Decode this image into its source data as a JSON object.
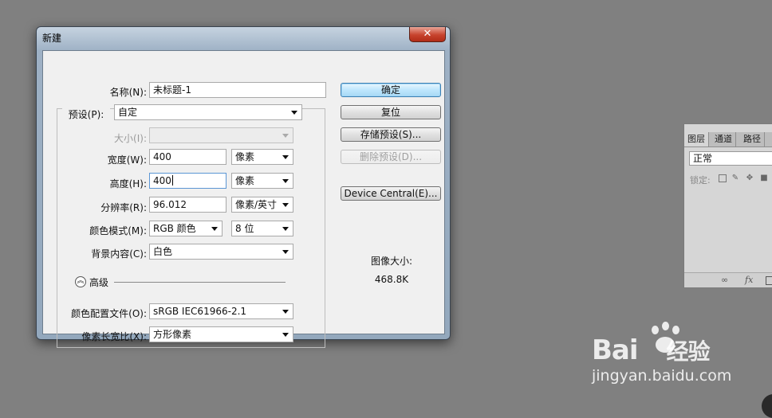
{
  "dialog": {
    "title": "新建",
    "close": "✕",
    "name_label": "名称(N):",
    "name_value": "未标题-1",
    "preset_label": "预设(P):",
    "preset_value": "自定",
    "size_label": "大小(I):",
    "size_value": "",
    "width_label": "宽度(W):",
    "width_value": "400",
    "width_unit": "像素",
    "height_label": "高度(H):",
    "height_value": "400",
    "height_unit": "像素",
    "resolution_label": "分辨率(R):",
    "resolution_value": "96.012",
    "resolution_unit": "像素/英寸",
    "color_mode_label": "颜色模式(M):",
    "color_mode_value": "RGB 颜色",
    "bit_depth_value": "8 位",
    "background_label": "背景内容(C):",
    "background_value": "白色",
    "advanced_label": "高级",
    "profile_label": "颜色配置文件(O):",
    "profile_value": "sRGB IEC61966-2.1",
    "pixel_aspect_label": "像素长宽比(X):",
    "pixel_aspect_value": "方形像素",
    "buttons": {
      "ok": "确定",
      "reset": "复位",
      "save_preset": "存储预设(S)...",
      "delete_preset": "删除预设(D)...",
      "device_central": "Device Central(E)..."
    },
    "image_size_label": "图像大小:",
    "image_size_value": "468.8K"
  },
  "layers_panel": {
    "tabs": [
      "图层",
      "通道",
      "路径"
    ],
    "blend_mode": "正常",
    "lock_label": "锁定:"
  },
  "watermark": {
    "logo": "Bai",
    "logo_cn": "经验",
    "url": "jingyan.baidu.com"
  },
  "colors": {
    "desktop": "#808080",
    "default_button": "#bee6fd",
    "close_button": "#c7432d"
  }
}
